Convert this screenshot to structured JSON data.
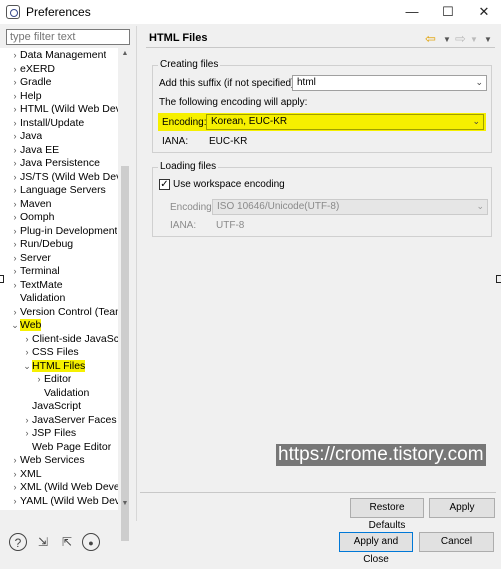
{
  "window": {
    "title": "Preferences",
    "minimize": "—",
    "maximize": "☐",
    "close": "✕"
  },
  "filter": {
    "placeholder": "type filter text"
  },
  "tree": [
    {
      "label": "Data Management",
      "arrow": "›",
      "indent": 0,
      "highlight": false
    },
    {
      "label": "eXERD",
      "arrow": "›",
      "indent": 0,
      "highlight": false
    },
    {
      "label": "Gradle",
      "arrow": "›",
      "indent": 0,
      "highlight": false
    },
    {
      "label": "Help",
      "arrow": "›",
      "indent": 0,
      "highlight": false
    },
    {
      "label": "HTML (Wild Web Develo",
      "arrow": "›",
      "indent": 0,
      "highlight": false
    },
    {
      "label": "Install/Update",
      "arrow": "›",
      "indent": 0,
      "highlight": false
    },
    {
      "label": "Java",
      "arrow": "›",
      "indent": 0,
      "highlight": false
    },
    {
      "label": "Java EE",
      "arrow": "›",
      "indent": 0,
      "highlight": false
    },
    {
      "label": "Java Persistence",
      "arrow": "›",
      "indent": 0,
      "highlight": false
    },
    {
      "label": "JS/TS (Wild Web Develo",
      "arrow": "›",
      "indent": 0,
      "highlight": false
    },
    {
      "label": "Language Servers",
      "arrow": "›",
      "indent": 0,
      "highlight": false
    },
    {
      "label": "Maven",
      "arrow": "›",
      "indent": 0,
      "highlight": false
    },
    {
      "label": "Oomph",
      "arrow": "›",
      "indent": 0,
      "highlight": false
    },
    {
      "label": "Plug-in Development",
      "arrow": "›",
      "indent": 0,
      "highlight": false
    },
    {
      "label": "Run/Debug",
      "arrow": "›",
      "indent": 0,
      "highlight": false
    },
    {
      "label": "Server",
      "arrow": "›",
      "indent": 0,
      "highlight": false
    },
    {
      "label": "Terminal",
      "arrow": "›",
      "indent": 0,
      "highlight": false
    },
    {
      "label": "TextMate",
      "arrow": "›",
      "indent": 0,
      "highlight": false
    },
    {
      "label": "Validation",
      "arrow": "",
      "indent": 0,
      "highlight": false
    },
    {
      "label": "Version Control (Team)",
      "arrow": "›",
      "indent": 0,
      "highlight": false
    },
    {
      "label": "Web",
      "arrow": "⌄",
      "indent": 0,
      "highlight": true
    },
    {
      "label": "Client-side JavaScript",
      "arrow": "›",
      "indent": 1,
      "highlight": false
    },
    {
      "label": "CSS Files",
      "arrow": "›",
      "indent": 1,
      "highlight": false
    },
    {
      "label": "HTML Files",
      "arrow": "⌄",
      "indent": 1,
      "highlight": true
    },
    {
      "label": "Editor",
      "arrow": "›",
      "indent": 2,
      "highlight": false
    },
    {
      "label": "Validation",
      "arrow": "",
      "indent": 2,
      "highlight": false
    },
    {
      "label": "JavaScript",
      "arrow": "",
      "indent": 1,
      "highlight": false
    },
    {
      "label": "JavaServer Faces Too",
      "arrow": "›",
      "indent": 1,
      "highlight": false
    },
    {
      "label": "JSP Files",
      "arrow": "›",
      "indent": 1,
      "highlight": false
    },
    {
      "label": "Web Page Editor",
      "arrow": "",
      "indent": 1,
      "highlight": false
    },
    {
      "label": "Web Services",
      "arrow": "›",
      "indent": 0,
      "highlight": false
    },
    {
      "label": "XML",
      "arrow": "›",
      "indent": 0,
      "highlight": false
    },
    {
      "label": "XML (Wild Web Develop",
      "arrow": "›",
      "indent": 0,
      "highlight": false
    },
    {
      "label": "YAML (Wild Web Develo",
      "arrow": "›",
      "indent": 0,
      "highlight": false
    }
  ],
  "page": {
    "title": "HTML Files"
  },
  "nav": {
    "back": "⇦",
    "forward": "⇨",
    "dropdown": "▼",
    "menu": "▼"
  },
  "creating": {
    "group_label": "Creating files",
    "suffix_label": "Add this suffix (if not specified):",
    "suffix_value": "html",
    "encoding_note": "The following encoding will apply:",
    "encoding_label": "Encoding:",
    "encoding_value": "Korean, EUC-KR",
    "iana_label": "IANA:",
    "iana_value": "EUC-KR"
  },
  "loading": {
    "group_label": "Loading files",
    "checkbox_label": "Use workspace encoding",
    "checked": true,
    "encoding_label": "Encoding:",
    "encoding_value": "ISO 10646/Unicode(UTF-8)",
    "iana_label": "IANA:",
    "iana_value": "UTF-8"
  },
  "buttons": {
    "restore": "Restore Defaults",
    "apply": "Apply",
    "apply_close": "Apply and Close",
    "cancel": "Cancel"
  },
  "watermark": "https://crome.tistory.com",
  "bottom_icons": [
    "help-icon",
    "import-icon",
    "export-icon",
    "record-icon"
  ],
  "colors": {
    "highlight": "#f6f000",
    "primary_border": "#0078d7"
  }
}
